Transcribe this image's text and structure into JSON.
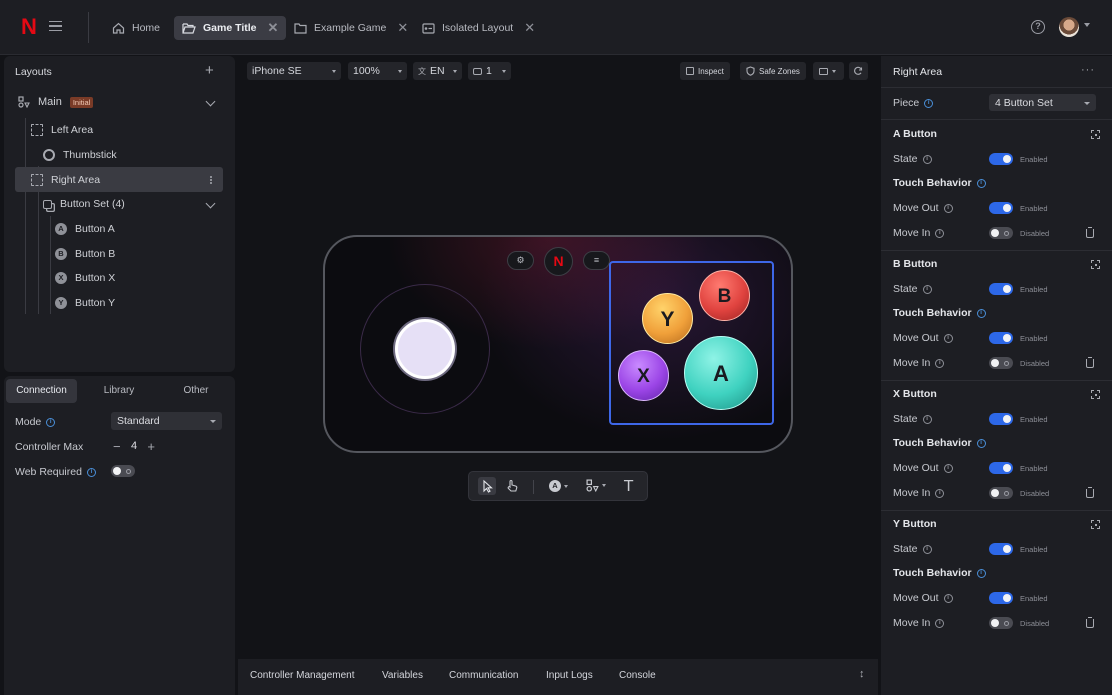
{
  "topbar": {
    "logo": "N",
    "tabs": [
      {
        "label": "Home",
        "icon": "home-icon",
        "closable": false,
        "active": false
      },
      {
        "label": "Game Title",
        "icon": "folder-open-icon",
        "closable": true,
        "active": true
      },
      {
        "label": "Example Game",
        "icon": "folder-icon",
        "closable": true,
        "active": false
      },
      {
        "label": "Isolated Layout",
        "icon": "layout-icon",
        "closable": true,
        "active": false
      }
    ],
    "help_glyph": "?"
  },
  "layouts": {
    "title": "Layouts",
    "tree": [
      {
        "label": "Main",
        "badge": "Initial",
        "icon": "layout-tree-icon"
      },
      {
        "label": "Left Area",
        "icon": "area-icon"
      },
      {
        "label": "Thumbstick",
        "icon": "thumbstick-icon"
      },
      {
        "label": "Right Area",
        "icon": "area-icon",
        "selected": true
      },
      {
        "label": "Button Set (4)",
        "icon": "button-set-icon"
      },
      {
        "label": "Button A",
        "glyph": "A"
      },
      {
        "label": "Button B",
        "glyph": "B"
      },
      {
        "label": "Button X",
        "glyph": "X"
      },
      {
        "label": "Button Y",
        "glyph": "Y"
      }
    ]
  },
  "settings": {
    "tabs": [
      "Connection",
      "Library",
      "Other"
    ],
    "active_tab": "Connection",
    "mode_label": "Mode",
    "mode_value": "Standard",
    "controller_max_label": "Controller Max",
    "controller_max_value": "4",
    "web_required_label": "Web Required",
    "web_required": false
  },
  "canvas_toolbar": {
    "device": "iPhone SE",
    "zoom": "100%",
    "language": "EN",
    "players": "1",
    "inspect_label": "Inspect",
    "safe_zones_label": "Safe Zones"
  },
  "controller": {
    "buttons": [
      {
        "glyph": "Y",
        "color": "#f3a23a"
      },
      {
        "glyph": "B",
        "color": "#e0433f"
      },
      {
        "glyph": "X",
        "color": "#9b45e6"
      },
      {
        "glyph": "A",
        "color": "#3fd2c0"
      }
    ],
    "brand_glyph": "N"
  },
  "bottom_tabs": [
    "Controller Management",
    "Variables",
    "Communication",
    "Input Logs",
    "Console"
  ],
  "inspector": {
    "title": "Right Area",
    "piece_label": "Piece",
    "piece_value": "4 Button Set",
    "enabled_text": "Enabled",
    "disabled_text": "Disabled",
    "state_label": "State",
    "touch_behavior_label": "Touch Behavior",
    "move_out_label": "Move Out",
    "move_in_label": "Move In",
    "sections": [
      {
        "title": "A Button",
        "state": true,
        "move_out": true,
        "move_in": false
      },
      {
        "title": "B Button",
        "state": true,
        "move_out": true,
        "move_in": false
      },
      {
        "title": "X Button",
        "state": true,
        "move_out": true,
        "move_in": false
      },
      {
        "title": "Y Button",
        "state": true,
        "move_out": true,
        "move_in": false
      }
    ]
  }
}
